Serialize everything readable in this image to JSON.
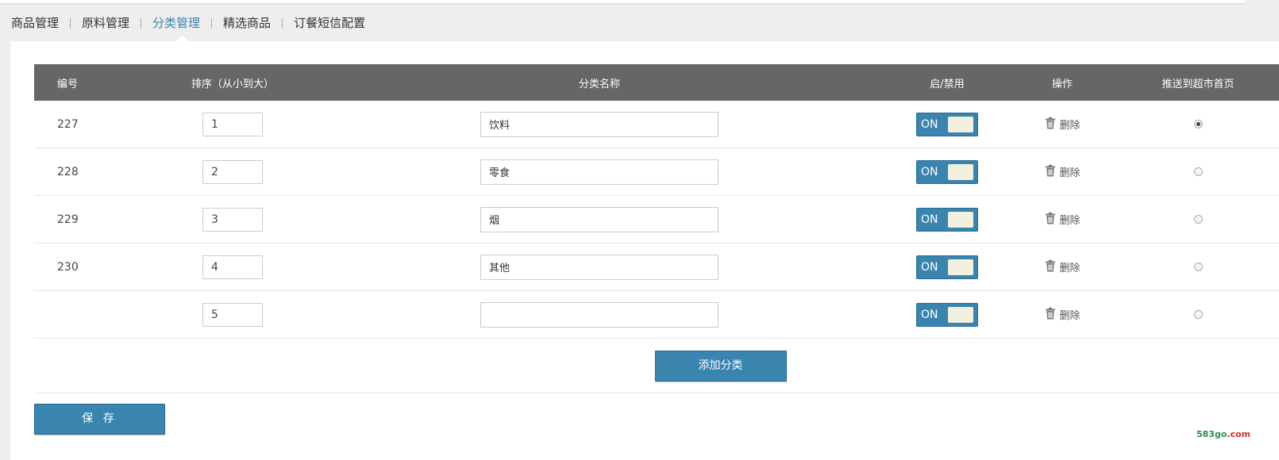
{
  "nav": {
    "tabs": [
      {
        "label": "商品管理"
      },
      {
        "label": "原料管理"
      },
      {
        "label": "分类管理"
      },
      {
        "label": "精选商品"
      },
      {
        "label": "订餐短信配置"
      }
    ],
    "active_index": 2
  },
  "table": {
    "headers": {
      "id": "编号",
      "sort": "排序（从小到大）",
      "name": "分类名称",
      "status": "启/禁用",
      "action": "操作",
      "push": "推送到超市首页"
    },
    "rows": [
      {
        "id": "227",
        "sort": "1",
        "name": "饮料",
        "toggle": "ON",
        "delete": "删除",
        "push_selected": true
      },
      {
        "id": "228",
        "sort": "2",
        "name": "零食",
        "toggle": "ON",
        "delete": "删除",
        "push_selected": false
      },
      {
        "id": "229",
        "sort": "3",
        "name": "烟",
        "toggle": "ON",
        "delete": "删除",
        "push_selected": false
      },
      {
        "id": "230",
        "sort": "4",
        "name": "其他",
        "toggle": "ON",
        "delete": "删除",
        "push_selected": false
      },
      {
        "id": "",
        "sort": "5",
        "name": "",
        "toggle": "ON",
        "delete": "删除",
        "push_selected": false
      }
    ]
  },
  "buttons": {
    "add_category": "添加分类",
    "save": "保 存"
  },
  "watermark": {
    "part1": "583go",
    "part2": ".com"
  },
  "colors": {
    "accent": "#3a84b0",
    "header_bg": "#666666",
    "toggle_knob": "#f3f0e0",
    "page_bg": "#eeeeee"
  },
  "icons": {
    "delete": "trash-icon"
  }
}
